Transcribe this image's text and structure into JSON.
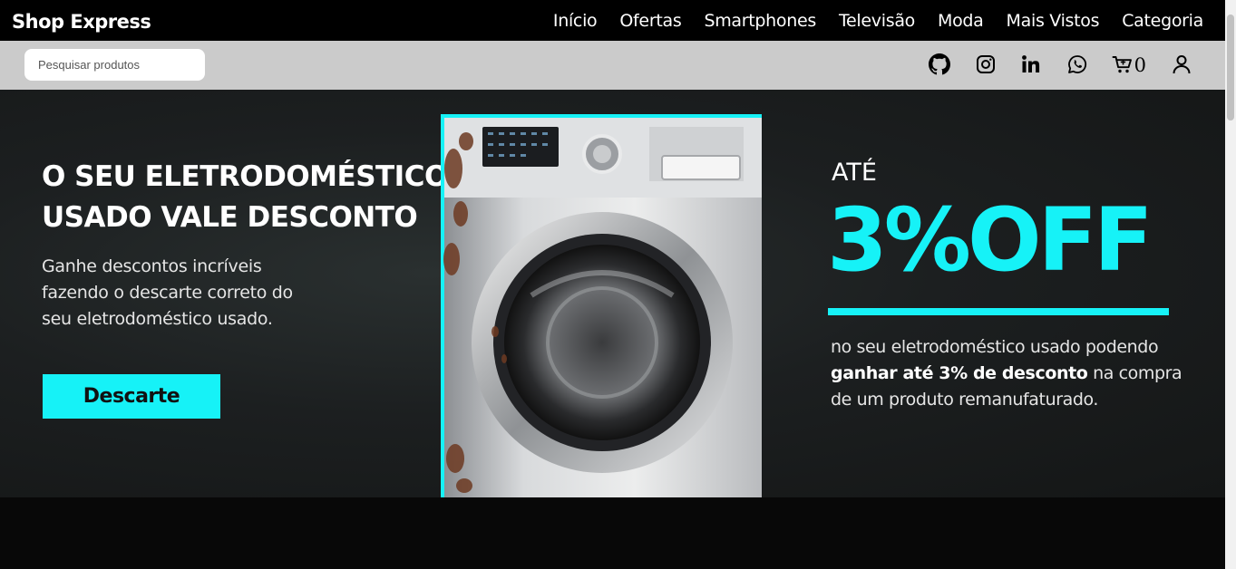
{
  "navbar": {
    "brand": "Shop Express",
    "links": [
      "Início",
      "Ofertas",
      "Smartphones",
      "Televisão",
      "Moda",
      "Mais Vistos",
      "Categoria"
    ]
  },
  "subbar": {
    "search_placeholder": "Pesquisar produtos",
    "icons": [
      "github-icon",
      "instagram-icon",
      "linkedin-icon",
      "whatsapp-icon",
      "cart-icon",
      "user-icon"
    ],
    "cart_count": "0"
  },
  "hero": {
    "title": "O SEU ELETRODOMÉSTICO\nUSADO VALE DESCONTO",
    "text": "Ganhe descontos incríveis\nfazendo o descarte correto do\nseu eletrodoméstico usado.",
    "button_label": "Descarte",
    "ate": "ATÉ",
    "discount": "3%OFF",
    "promo_before": "no seu eletrodoméstico usado podendo ",
    "promo_bold": "ganhar até 3% de desconto",
    "promo_after": " na compra de um produto remanufaturado.",
    "accent_color": "#16f2f7"
  }
}
